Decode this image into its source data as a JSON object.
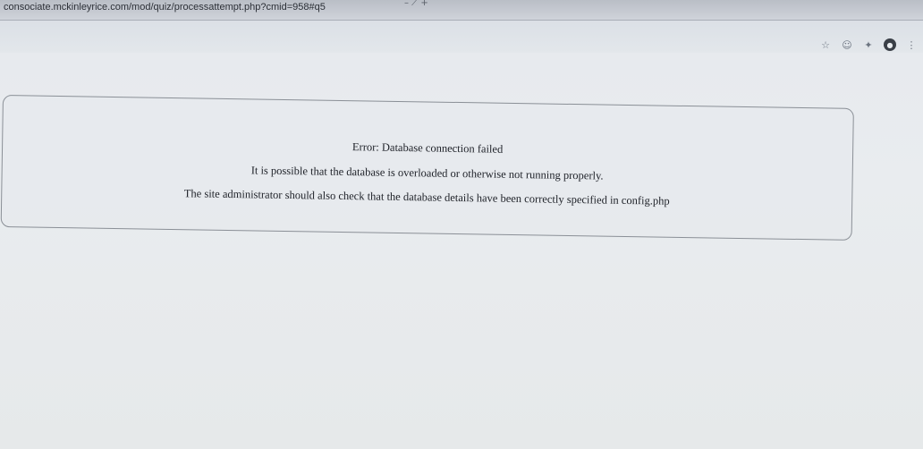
{
  "browser": {
    "url": "consociate.mckinleyrice.com/mod/quiz/processattempt.php?cmid=958#q5",
    "tab_marks": "– ⟋ +",
    "toolbar_icons": [
      "star-icon",
      "smiley-icon",
      "extension-icon",
      "profile-icon",
      "menu-icon"
    ],
    "star_glyph": "☆",
    "smiley_glyph": "☺",
    "extension_glyph": "✦",
    "profile_glyph": "●",
    "menu_glyph": "⋮"
  },
  "error": {
    "title": "Error: Database connection failed",
    "line2": "It is possible that the database is overloaded or otherwise not running properly.",
    "line3": "The site administrator should also check that the database details have been correctly specified in config.php"
  }
}
